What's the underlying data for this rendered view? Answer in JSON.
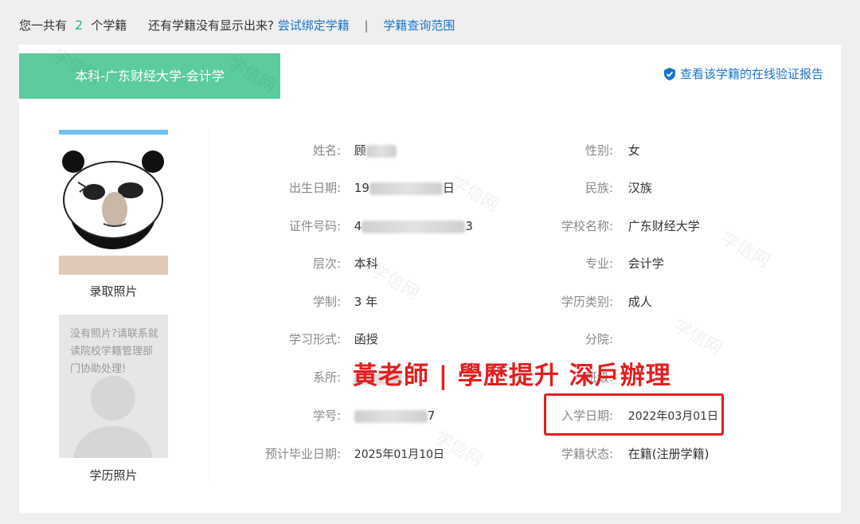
{
  "topbar": {
    "prefix": "您一共有",
    "count": "2",
    "suffix": "个学籍",
    "question": "还有学籍没有显示出来?",
    "bind_link": "尝试绑定学籍",
    "separator": "|",
    "scope_link": "学籍查询范围"
  },
  "card": {
    "title": "本科-广东财经大学-会计学",
    "verify_link": "查看该学籍的在线验证报告",
    "admission_photo_caption": "录取照片",
    "no_photo_message": "没有照片?请联系就读院校学籍管理部门协助处理!",
    "education_photo_caption": "学历照片",
    "watermark": "学信网"
  },
  "fields": {
    "name": {
      "label": "姓名:",
      "value": "顾"
    },
    "gender": {
      "label": "性别:",
      "value": "女"
    },
    "birthdate": {
      "label": "出生日期:",
      "value_start": "19",
      "value_end": "日"
    },
    "ethnicity": {
      "label": "民族:",
      "value": "汉族"
    },
    "id_number": {
      "label": "证件号码:",
      "value_start": "4",
      "value_end": "3"
    },
    "school": {
      "label": "学校名称:",
      "value": "广东财经大学"
    },
    "level": {
      "label": "层次:",
      "value": "本科"
    },
    "major": {
      "label": "专业:",
      "value": "会计学"
    },
    "duration": {
      "label": "学制:",
      "value": "3 年"
    },
    "edu_type": {
      "label": "学历类别:",
      "value": "成人"
    },
    "study_form": {
      "label": "学习形式:",
      "value": "函授"
    },
    "branch": {
      "label": "分院:",
      "value": ""
    },
    "department": {
      "label": "系所:",
      "value": ""
    },
    "class": {
      "label": "班级:",
      "value": ""
    },
    "student_id": {
      "label": "学号:",
      "value_end": "7"
    },
    "enroll_date": {
      "label": "入学日期:",
      "value": "2022年03月01日"
    },
    "expected_grad": {
      "label": "预计毕业日期:",
      "value": "2025年01月10日"
    },
    "status": {
      "label": "学籍状态:",
      "value": "在籍(注册学籍)"
    }
  },
  "overlay_text": "黃老師 | 學歷提升 深戶辦理",
  "colors": {
    "accent_green": "#5ccb9e",
    "link_blue": "#1a73c8",
    "count_green": "#2bb673",
    "overlay_red": "#e21e1e"
  }
}
